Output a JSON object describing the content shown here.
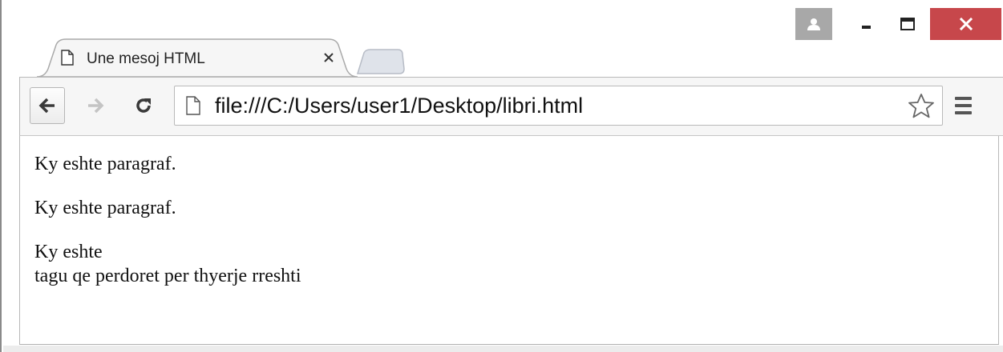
{
  "window": {
    "controls": [
      "profile",
      "minimize",
      "maximize",
      "close"
    ],
    "close_color": "#c7474b"
  },
  "tab": {
    "title": "Une mesoj HTML",
    "favicon": "page-icon",
    "close_icon": "close-icon"
  },
  "toolbar": {
    "back_icon": "back-arrow-icon",
    "forward_icon": "forward-arrow-icon",
    "reload_icon": "reload-icon",
    "bookmark_icon": "star-icon",
    "menu_icon": "hamburger-menu-icon"
  },
  "omnibox": {
    "url": "file:///C:/Users/user1/Desktop/libri.html"
  },
  "page": {
    "paragraph_1": "Ky eshte paragraf.",
    "paragraph_2": "Ky eshte paragraf.",
    "paragraph_3_line_1": "Ky eshte",
    "paragraph_3_line_2": "tagu qe perdoret per thyerje rreshti"
  }
}
